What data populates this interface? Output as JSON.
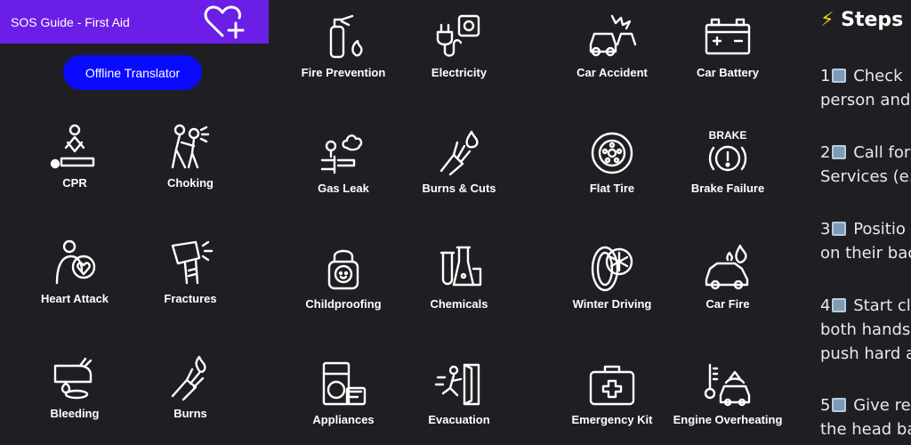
{
  "header": {
    "title": "SOS Guide - First Aid"
  },
  "translator": {
    "label": "Offline Translator"
  },
  "tiles": {
    "cpr": "CPR",
    "choking": "Choking",
    "heart_attack": "Heart Attack",
    "fractures": "Fractures",
    "bleeding": "Bleeding",
    "burns": "Burns",
    "fire_prevention": "Fire Prevention",
    "electricity": "Electricity",
    "gas_leak": "Gas Leak",
    "burns_cuts": "Burns & Cuts",
    "childproofing": "Childproofing",
    "chemicals": "Chemicals",
    "appliances": "Appliances",
    "evacuation": "Evacuation",
    "car_accident": "Car Accident",
    "car_battery": "Car Battery",
    "flat_tire": "Flat Tire",
    "brake_failure": "Brake Failure",
    "winter_driving": "Winter Driving",
    "car_fire": "Car Fire",
    "emergency_kit": "Emergency Kit",
    "engine_overheating": "Engine Overheating"
  },
  "icon_text": {
    "brake": "BRAKE"
  },
  "steps": {
    "heading": "Steps",
    "items": [
      {
        "num": "1",
        "line1": "Check",
        "line2": "person and"
      },
      {
        "num": "2",
        "line1": "Call for",
        "line2": "Services (e."
      },
      {
        "num": "3",
        "line1": "Positio",
        "line2": "on their bac"
      },
      {
        "num": "4",
        "line1": "Start cl",
        "line2": "both hands",
        "line3": "push hard a"
      },
      {
        "num": "5",
        "line1": "Give re",
        "line2": "the head ba"
      }
    ]
  },
  "colors": {
    "header": "#6b1ee6",
    "button": "#0a0aff",
    "background": "#1f1f23"
  }
}
